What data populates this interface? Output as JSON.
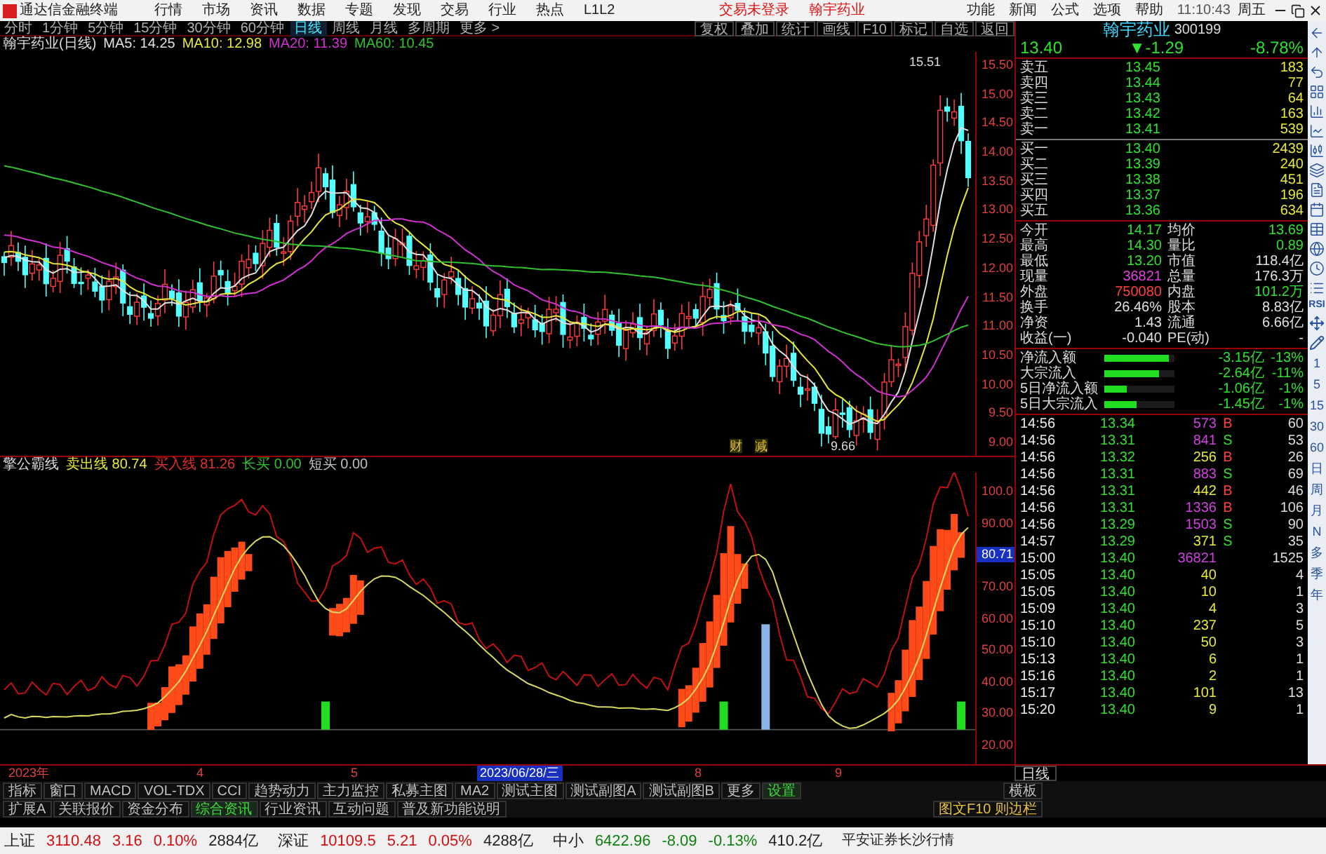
{
  "menu_bar": {
    "app_title": "通达信金融终端",
    "items": [
      "行情",
      "市场",
      "资讯",
      "数据",
      "专题",
      "发现",
      "交易",
      "行业",
      "热点",
      "L1L2"
    ],
    "notices": [
      "交易未登录",
      "翰宇药业"
    ],
    "right_items": [
      "功能",
      "新闻",
      "公式",
      "选项",
      "帮助"
    ],
    "time": "11:10:43",
    "weekday": "周五"
  },
  "period_toolbar": {
    "periods": [
      {
        "label": "分时",
        "selected": false
      },
      {
        "label": "1分钟",
        "selected": false
      },
      {
        "label": "5分钟",
        "selected": false
      },
      {
        "label": "15分钟",
        "selected": false
      },
      {
        "label": "30分钟",
        "selected": false
      },
      {
        "label": "60分钟",
        "selected": false
      },
      {
        "label": "日线",
        "selected": true
      },
      {
        "label": "周线",
        "selected": false
      },
      {
        "label": "月线",
        "selected": false
      },
      {
        "label": "多周期",
        "selected": false
      },
      {
        "label": "更多 >",
        "selected": false
      }
    ],
    "tools": [
      "复权",
      "叠加",
      "统计",
      "画线",
      "F10",
      "标记",
      "自选",
      "返回"
    ]
  },
  "main_chart": {
    "title": "翰宇药业(日线)",
    "ma": [
      {
        "label": "MA5: 14.25",
        "color": "#e0e0e0"
      },
      {
        "label": "MA10: 12.98",
        "color": "#e8e83a"
      },
      {
        "label": "MA20: 11.39",
        "color": "#d030d0"
      },
      {
        "label": "MA60: 10.45",
        "color": "#30c030"
      }
    ],
    "y_axis": [
      "15.50",
      "15.00",
      "14.50",
      "14.00",
      "13.50",
      "13.00",
      "12.50",
      "12.00",
      "11.50",
      "11.00",
      "10.50",
      "10.00",
      "9.50",
      "9.00"
    ],
    "high_label": "15.51",
    "low_label": "9.66",
    "event_marks": [
      "财",
      "减"
    ]
  },
  "indicator": {
    "name": "擎公霸线",
    "values": [
      {
        "label": "卖出线",
        "value": "80.74",
        "color": "#e8e83a"
      },
      {
        "label": "买入线",
        "value": "81.26",
        "color": "#e03030"
      },
      {
        "label": "长买",
        "value": "0.00",
        "color": "#30c030"
      },
      {
        "label": "短买",
        "value": "0.00",
        "color": "#c0c0c0"
      }
    ],
    "y_axis": [
      "100.0",
      "90.00",
      "80.71",
      "70.00",
      "60.00",
      "50.00",
      "40.00",
      "30.00",
      "20.00"
    ]
  },
  "date_axis": [
    {
      "label": "2023年",
      "selected": false
    },
    {
      "label": "4",
      "selected": false
    },
    {
      "label": "5",
      "selected": false
    },
    {
      "label": "2023/06/28/三",
      "selected": true
    },
    {
      "label": "8",
      "selected": false
    },
    {
      "label": "9",
      "selected": false
    }
  ],
  "date_axis_right": "日线",
  "indicator_tabs": [
    {
      "label": "指标",
      "selected": false
    },
    {
      "label": "窗口",
      "selected": false
    },
    {
      "label": "MACD",
      "selected": false
    },
    {
      "label": "VOL-TDX",
      "selected": false
    },
    {
      "label": "CCI",
      "selected": false
    },
    {
      "label": "趋势动力",
      "selected": false
    },
    {
      "label": "主力监控",
      "selected": false
    },
    {
      "label": "私募主图",
      "selected": false
    },
    {
      "label": "MA2",
      "selected": false
    },
    {
      "label": "测试主图",
      "selected": false
    },
    {
      "label": "测试副图A",
      "selected": false
    },
    {
      "label": "测试副图B",
      "selected": false
    },
    {
      "label": "更多",
      "selected": false
    },
    {
      "label": "设置",
      "selected": true
    }
  ],
  "indicator_tabs_right": "横板",
  "info_tabs": [
    {
      "label": "扩展A",
      "selected": false
    },
    {
      "label": "关联报价",
      "selected": false
    },
    {
      "label": "资金分布",
      "selected": false
    },
    {
      "label": "综合资讯",
      "selected": true
    },
    {
      "label": "行业资讯",
      "selected": false
    },
    {
      "label": "互动问题",
      "selected": false
    },
    {
      "label": "普及新功能说明",
      "selected": false
    }
  ],
  "info_tabs_right": "图文F10 则边栏",
  "quote": {
    "name": "翰宇药业",
    "code": "300199",
    "price": "13.40",
    "change": "▼-1.29",
    "pct": "-8.78%",
    "asks": [
      {
        "label": "卖五",
        "price": "13.45",
        "volume": "183"
      },
      {
        "label": "卖四",
        "price": "13.44",
        "volume": "77"
      },
      {
        "label": "卖三",
        "price": "13.43",
        "volume": "64"
      },
      {
        "label": "卖二",
        "price": "13.42",
        "volume": "163"
      },
      {
        "label": "卖一",
        "price": "13.41",
        "volume": "539"
      }
    ],
    "bids": [
      {
        "label": "买一",
        "price": "13.40",
        "volume": "2439"
      },
      {
        "label": "买二",
        "price": "13.39",
        "volume": "240"
      },
      {
        "label": "买三",
        "price": "13.38",
        "volume": "451"
      },
      {
        "label": "买四",
        "price": "13.37",
        "volume": "196"
      },
      {
        "label": "买五",
        "price": "13.36",
        "volume": "634"
      }
    ],
    "stats": [
      {
        "label": "今开",
        "value": "14.17",
        "kind": "down"
      },
      {
        "label": "均价",
        "value": "13.69",
        "kind": "down"
      },
      {
        "label": "最高",
        "value": "14.30",
        "kind": "down"
      },
      {
        "label": "量比",
        "value": "0.89",
        "kind": "down"
      },
      {
        "label": "最低",
        "value": "13.20",
        "kind": "down"
      },
      {
        "label": "市值",
        "value": "118.4亿",
        "kind": "plain"
      },
      {
        "label": "现量",
        "value": "36821",
        "kind": "volume"
      },
      {
        "label": "总量",
        "value": "176.3万",
        "kind": "plain"
      },
      {
        "label": "外盘",
        "value": "750080",
        "kind": "up"
      },
      {
        "label": "内盘",
        "value": "101.2万",
        "kind": "down"
      },
      {
        "label": "换手",
        "value": "26.46%",
        "kind": "plain"
      },
      {
        "label": "股本",
        "value": "8.83亿",
        "kind": "plain"
      },
      {
        "label": "净资",
        "value": "1.43",
        "kind": "plain"
      },
      {
        "label": "流通",
        "value": "6.66亿",
        "kind": "plain"
      },
      {
        "label": "收益(一)",
        "value": "-0.040",
        "kind": "plain"
      },
      {
        "label": "PE(动)",
        "value": "-",
        "kind": "plain"
      }
    ],
    "flows": [
      {
        "label": "净流入额",
        "level": 0.92,
        "amount": "-3.15亿",
        "pct": "-13%"
      },
      {
        "label": "大宗流入",
        "level": 0.78,
        "amount": "-2.64亿",
        "pct": "-11%"
      },
      {
        "label": "5日净流入额",
        "level": 0.32,
        "amount": "-1.06亿",
        "pct": "-1%"
      },
      {
        "label": "5日大宗流入",
        "level": 0.45,
        "amount": "-1.45亿",
        "pct": "-1%"
      }
    ],
    "trades": [
      {
        "time": "14:56",
        "price": "13.34",
        "volume": "573",
        "side": "B",
        "count": "60",
        "kind": "buy",
        "big": true
      },
      {
        "time": "14:56",
        "price": "13.31",
        "volume": "841",
        "side": "S",
        "count": "53",
        "kind": "sell",
        "big": true
      },
      {
        "time": "14:56",
        "price": "13.32",
        "volume": "256",
        "side": "B",
        "count": "26",
        "kind": "buy",
        "big": false
      },
      {
        "time": "14:56",
        "price": "13.31",
        "volume": "883",
        "side": "S",
        "count": "69",
        "kind": "sell",
        "big": true
      },
      {
        "time": "14:56",
        "price": "13.31",
        "volume": "442",
        "side": "B",
        "count": "46",
        "kind": "buy",
        "big": false
      },
      {
        "time": "14:56",
        "price": "13.31",
        "volume": "1336",
        "side": "B",
        "count": "106",
        "kind": "buy",
        "big": true
      },
      {
        "time": "14:56",
        "price": "13.29",
        "volume": "1503",
        "side": "S",
        "count": "90",
        "kind": "sell",
        "big": true
      },
      {
        "time": "14:57",
        "price": "13.29",
        "volume": "371",
        "side": "S",
        "count": "35",
        "kind": "sell",
        "big": false
      },
      {
        "time": "15:00",
        "price": "13.40",
        "volume": "36821",
        "count": "1525",
        "kind": "none",
        "big": true
      },
      {
        "time": "15:05",
        "price": "13.40",
        "volume": "40",
        "count": "4",
        "kind": "none",
        "big": false
      },
      {
        "time": "15:05",
        "price": "13.40",
        "volume": "10",
        "count": "1",
        "kind": "none",
        "big": false
      },
      {
        "time": "15:09",
        "price": "13.40",
        "volume": "4",
        "count": "3",
        "kind": "none",
        "big": false
      },
      {
        "time": "15:10",
        "price": "13.40",
        "volume": "237",
        "count": "5",
        "kind": "none",
        "big": false
      },
      {
        "time": "15:10",
        "price": "13.40",
        "volume": "50",
        "count": "3",
        "kind": "none",
        "big": false
      },
      {
        "time": "15:13",
        "price": "13.40",
        "volume": "6",
        "count": "1",
        "kind": "none",
        "big": false
      },
      {
        "time": "15:16",
        "price": "13.40",
        "volume": "2",
        "count": "1",
        "kind": "none",
        "big": false
      },
      {
        "time": "15:17",
        "price": "13.40",
        "volume": "101",
        "count": "13",
        "kind": "none",
        "big": false
      },
      {
        "time": "15:20",
        "price": "13.40",
        "volume": "9",
        "count": "1",
        "kind": "none",
        "big": false
      }
    ]
  },
  "sidebar": {
    "label": "RSI",
    "periods": [
      "1",
      "5",
      "15",
      "30",
      "60",
      "日",
      "周",
      "月",
      "N",
      "多",
      "季",
      "年"
    ]
  },
  "status_bar": {
    "indices": [
      {
        "name": "上证",
        "value": "3110.48",
        "change": "3.16",
        "pct": "0.10%",
        "amount": "2884亿",
        "kind": "up"
      },
      {
        "name": "深证",
        "value": "10109.5",
        "change": "5.21",
        "pct": "0.05%",
        "amount": "4288亿",
        "kind": "up"
      },
      {
        "name": "中小",
        "value": "6422.96",
        "change": "-8.09",
        "pct": "-0.13%",
        "amount": "410.2亿",
        "kind": "down"
      }
    ],
    "broker": "平安证券长沙行情"
  }
}
